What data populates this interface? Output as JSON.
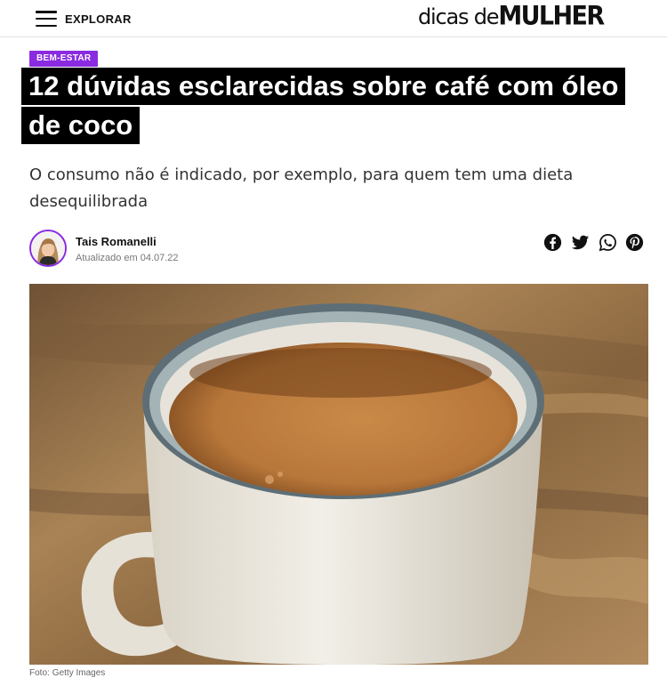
{
  "header": {
    "menu_label": "EXPLORAR",
    "logo": {
      "part_regular": "dicas de",
      "part_bold": "MULHER"
    }
  },
  "article": {
    "category": "BEM-ESTAR",
    "title": "12 dúvidas esclarecidas sobre café com óleo de coco",
    "subtitle": "O consumo não é indicado, por exemplo, para quem tem uma dieta desequilibrada",
    "author": {
      "name": "Tais Romanelli",
      "updated_label": "Atualizado em",
      "updated_date": "04.07.22"
    },
    "share": {
      "facebook": "facebook-icon",
      "twitter": "twitter-icon",
      "whatsapp": "whatsapp-icon",
      "pinterest": "pinterest-icon"
    },
    "image": {
      "credit_label": "Foto:",
      "credit_source": "Getty Images"
    }
  },
  "colors": {
    "accent": "#8a2be2",
    "title_background": "#000000",
    "title_text": "#ffffff"
  }
}
